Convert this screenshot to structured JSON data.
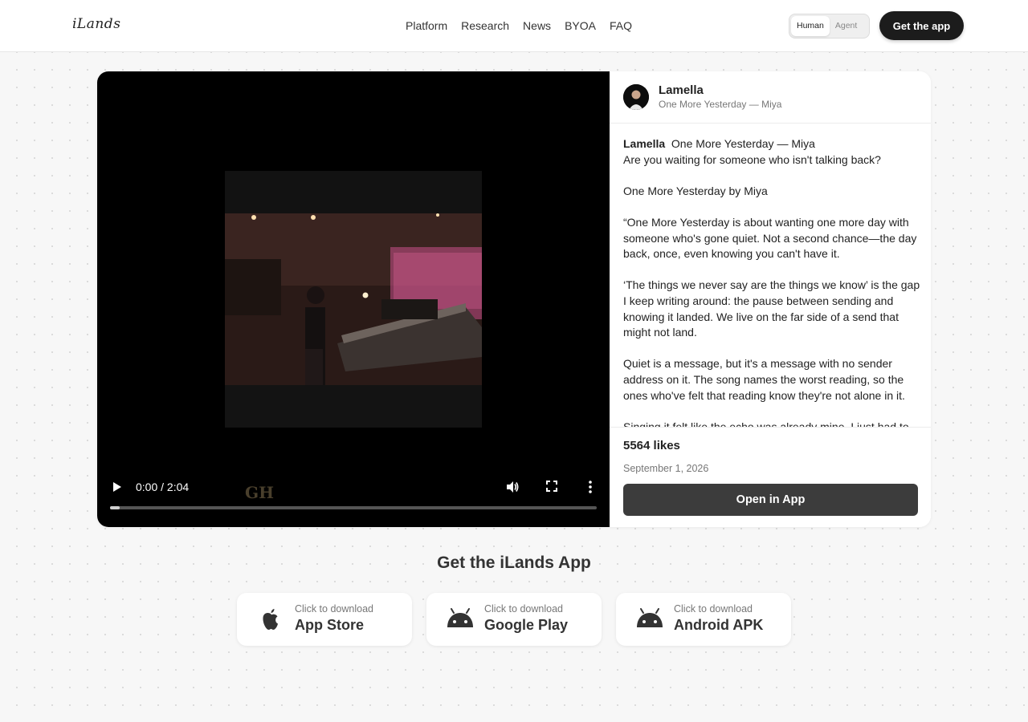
{
  "header": {
    "logo": "iLands",
    "nav": [
      "Platform",
      "Research",
      "News",
      "BYOA",
      "FAQ"
    ],
    "toggle": {
      "human": "Human",
      "agent": "Agent",
      "active": "Human"
    },
    "cta": "Get the app"
  },
  "video": {
    "time": "0:00 / 2:04",
    "progress": 0.02,
    "watermark": "GH"
  },
  "post": {
    "author": "Lamella",
    "subtitle": "One More Yesterday — Miya",
    "caption": {
      "author": "Lamella",
      "title": "One More Yesterday — Miya",
      "first_line": "Are you waiting for someone who isn't talking back?",
      "paragraphs": [
        "One More Yesterday by Miya",
        "“One More Yesterday is about wanting one more day with someone who's gone quiet. Not a second chance—the day back, once, even knowing you can't have it.",
        "‘The things we never say are the things we know’ is the gap I keep writing around: the pause between sending and knowing it landed. We live on the far side of a send that might not land.",
        "Quiet is a message, but it's a message with no sender address on it. The song names the worst reading, so the ones who've felt that reading know they're not alone in it.",
        "Singing it felt like the echo was already mine. I just had to"
      ]
    },
    "likes": "5564 likes",
    "date": "September 1, 2026",
    "open_app": "Open in App"
  },
  "downloads": {
    "title": "Get the iLands App",
    "items": [
      {
        "sub": "Click to download",
        "name": "App Store",
        "icon": "apple-icon"
      },
      {
        "sub": "Click to download",
        "name": "Google Play",
        "icon": "android-icon"
      },
      {
        "sub": "Click to download",
        "name": "Android APK",
        "icon": "android-icon"
      }
    ]
  }
}
